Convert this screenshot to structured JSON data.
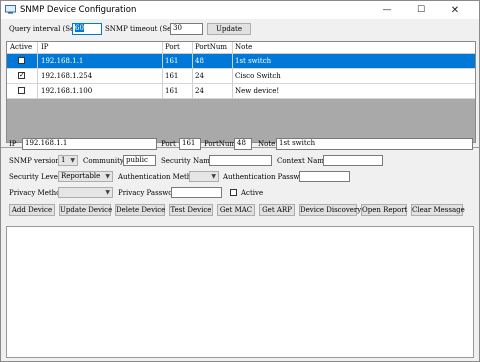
{
  "window": {
    "title": "SNMP Device Configuration",
    "minimize_glyph": "—",
    "maximize_glyph": "☐",
    "close_glyph": "✕"
  },
  "top": {
    "query_interval_label": "Query interval (Sec)",
    "query_interval_value": "60",
    "snmp_timeout_label": "SNMP timeout (Sec)",
    "snmp_timeout_value": "30",
    "update_label": "Update"
  },
  "table": {
    "headers": [
      "Active",
      "IP",
      "Port",
      "PortNum",
      "Note"
    ],
    "rows": [
      {
        "active": false,
        "ip": "192.168.1.1",
        "port": "161",
        "portnum": "48",
        "note": "1st switch",
        "selected": true
      },
      {
        "active": true,
        "ip": "192.168.1.254",
        "port": "161",
        "portnum": "24",
        "note": "Cisco Switch",
        "selected": false
      },
      {
        "active": false,
        "ip": "192.168.1.100",
        "port": "161",
        "portnum": "24",
        "note": "New device!",
        "selected": false
      }
    ]
  },
  "form": {
    "ip_label": "IP",
    "ip_value": "192.168.1.1",
    "port_label": "Port",
    "port_value": "161",
    "portnum_label": "PortNum",
    "portnum_value": "48",
    "note_label": "Note",
    "note_value": "1st switch",
    "snmp_version_label": "SNMP version",
    "snmp_version_value": "1",
    "community_label": "Community",
    "community_value": "public",
    "security_name_label": "Security Name",
    "security_name_value": "",
    "context_name_label": "Context Name",
    "context_name_value": "",
    "security_level_label": "Security Level",
    "security_level_value": "Reportable",
    "auth_method_label": "Authentication Method",
    "auth_method_value": "",
    "auth_password_label": "Authentication Password",
    "auth_password_value": "",
    "privacy_method_label": "Privacy Method",
    "privacy_method_value": "",
    "privacy_password_label": "Privacy Password",
    "privacy_password_value": "",
    "active_label": "Active"
  },
  "buttons": {
    "add_device": "Add Device",
    "update_device": "Update Device",
    "delete_device": "Delete Device",
    "test_device": "Test Device",
    "get_mac": "Get MAC",
    "get_arp": "Get ARP",
    "device_discovery": "Device Discovery",
    "open_report": "Open Report",
    "clear_message": "Clear Message"
  },
  "colors": {
    "selection": "#0078d7",
    "window_bg": "#f0f0f0"
  }
}
